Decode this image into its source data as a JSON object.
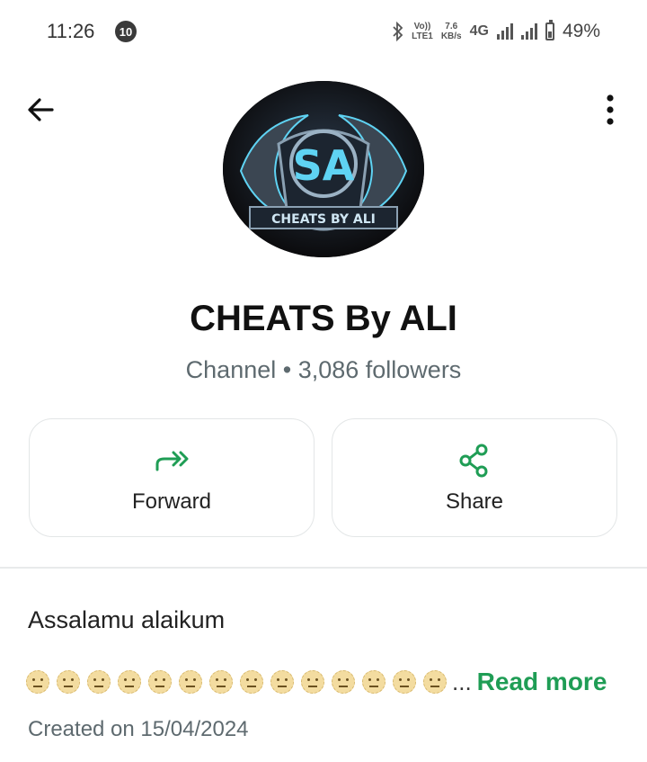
{
  "status_bar": {
    "time": "11:26",
    "notification_count": "10",
    "volte_top": "Vo))",
    "volte_bottom": "LTE1",
    "net_speed_value": "7.6",
    "net_speed_unit": "KB/s",
    "network_type": "4G",
    "battery_percent": "49%",
    "battery_level": 0.49
  },
  "header": {
    "back_icon": "arrow-left-icon",
    "menu_icon": "more-vertical-icon"
  },
  "channel": {
    "avatar_text": "CHEATS BY ALI",
    "avatar_monogram": "SA",
    "name": "CHEATS By ALI",
    "subtitle": "Channel • 3,086 followers"
  },
  "actions": {
    "forward_label": "Forward",
    "share_label": "Share",
    "accent_color": "#1f9d55"
  },
  "description": {
    "greeting": "Assalamu alaikum",
    "emoji_count": 14,
    "ellipsis": "...",
    "read_more": "Read more",
    "created": "Created on 15/04/2024"
  }
}
